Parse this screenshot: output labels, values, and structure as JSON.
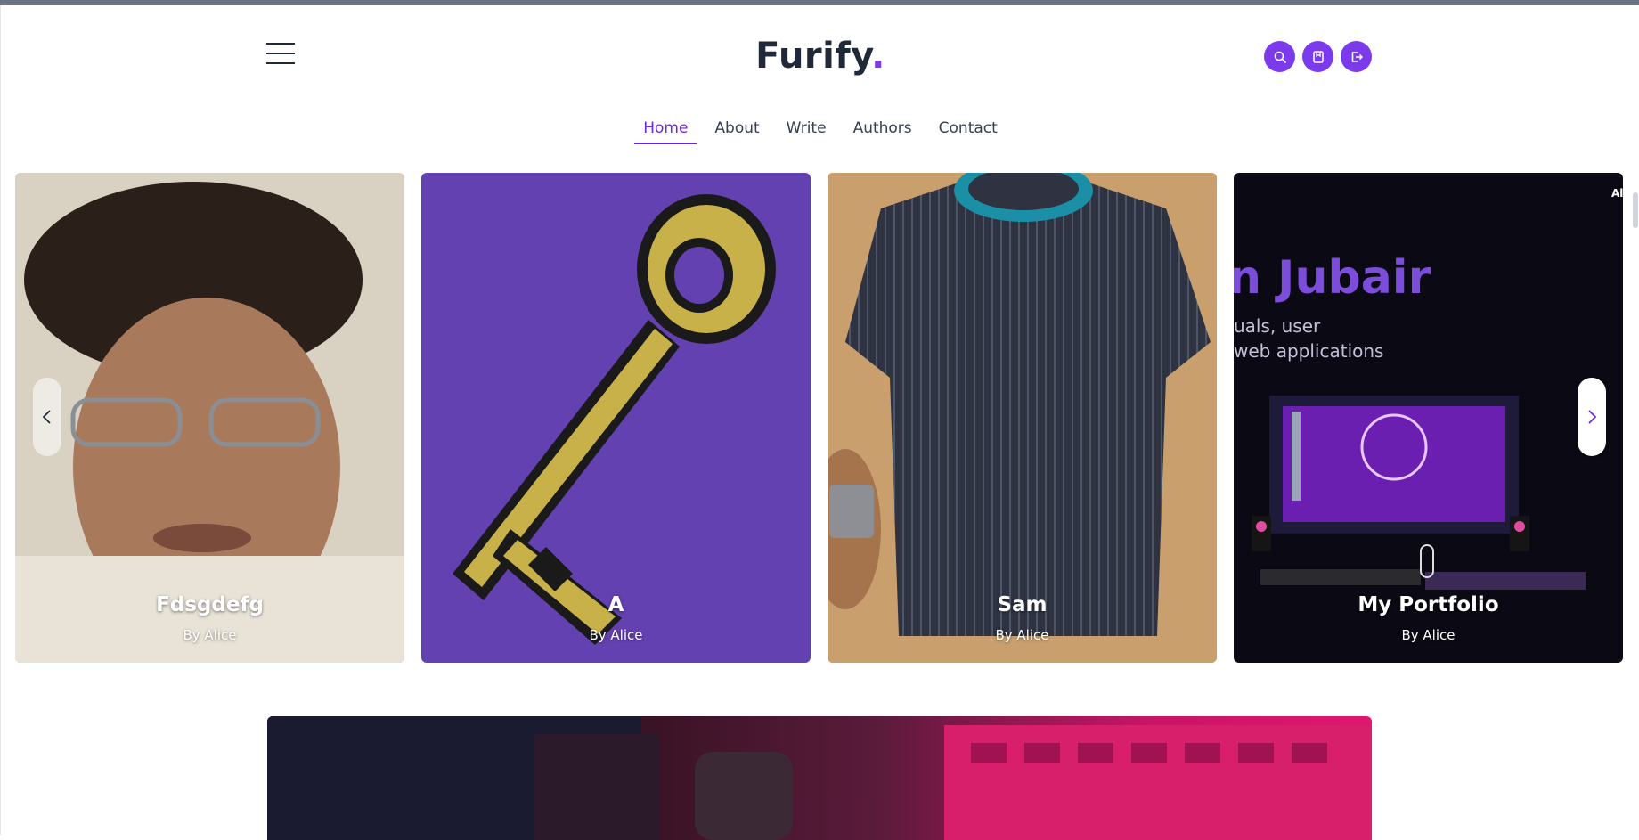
{
  "header": {
    "logo_text": "Furify",
    "logo_dot": ".",
    "icons": [
      "search-icon",
      "bookmark-icon",
      "logout-icon"
    ]
  },
  "nav": {
    "items": [
      "Home",
      "About",
      "Write",
      "Authors",
      "Contact"
    ],
    "active": "Home"
  },
  "carousel": {
    "cards": [
      {
        "title": "Fdsgdefg",
        "author": "By Alice"
      },
      {
        "title": "A",
        "author": "By Alice"
      },
      {
        "title": "Sam",
        "author": "By Alice"
      },
      {
        "title": "My Portfolio",
        "author": "By Alice"
      }
    ],
    "portfolio_image_text": {
      "name": "n Jubair",
      "line1": "uals, user",
      "line2": "web applications",
      "corner": "Al"
    }
  },
  "colors": {
    "accent": "#7c3aed",
    "key_card_bg": "#6441b0"
  }
}
